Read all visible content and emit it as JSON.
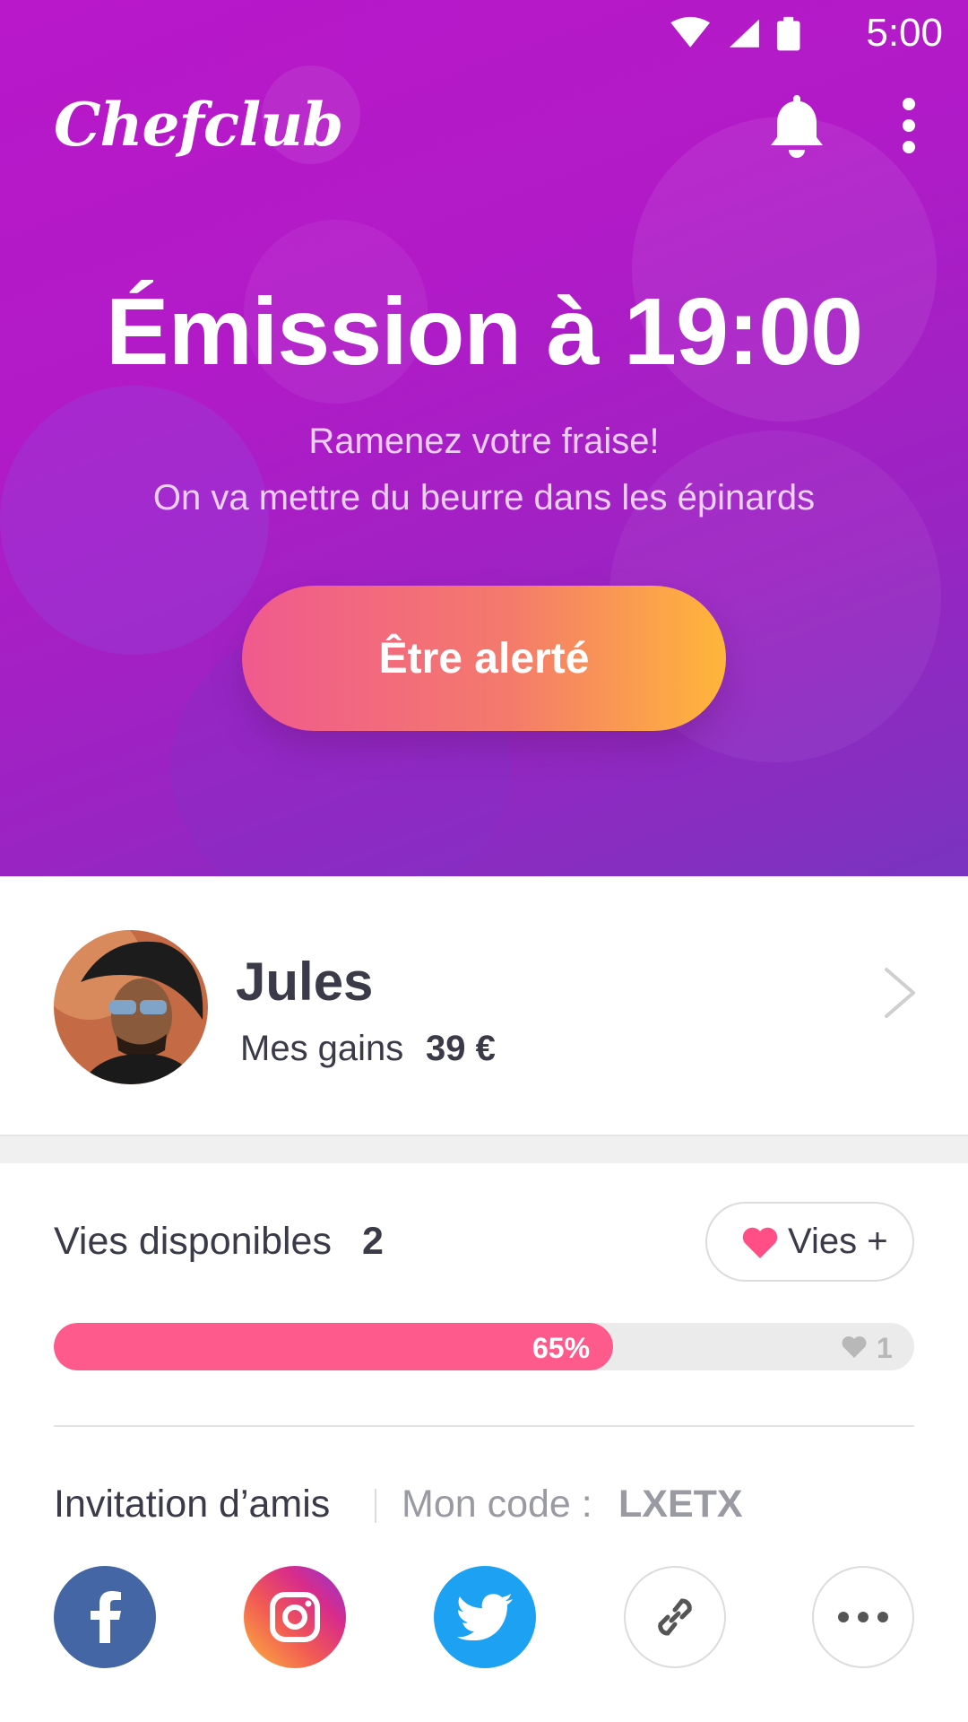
{
  "status_bar": {
    "time": "5:00"
  },
  "header": {
    "logo": "Chefclub"
  },
  "hero": {
    "title": "Émission à 19:00",
    "subtitle_line1": "Ramenez votre fraise!",
    "subtitle_line2": "On va mettre du beurre dans les épinards",
    "cta_label": "Être alerté"
  },
  "profile": {
    "name": "Jules",
    "earnings_label": "Mes gains",
    "earnings_value": "39 €"
  },
  "lives": {
    "label": "Vies disponibles",
    "count": "2",
    "button_label": "Vies +",
    "progress_percent": 65,
    "progress_label": "65%",
    "next_lives": "1"
  },
  "invite": {
    "label": "Invitation d’amis",
    "code_label": "Mon code :",
    "code_value": "LXETX"
  },
  "share_icons": [
    "facebook-icon",
    "instagram-icon",
    "twitter-icon",
    "link-icon",
    "more-horizontal-icon"
  ],
  "colors": {
    "hero_start": "#b818c9",
    "hero_end": "#7a34bf",
    "cta_start": "#f05a8e",
    "cta_end": "#ffb63a",
    "progress": "#ff5a8c",
    "text": "#3a3a48"
  }
}
